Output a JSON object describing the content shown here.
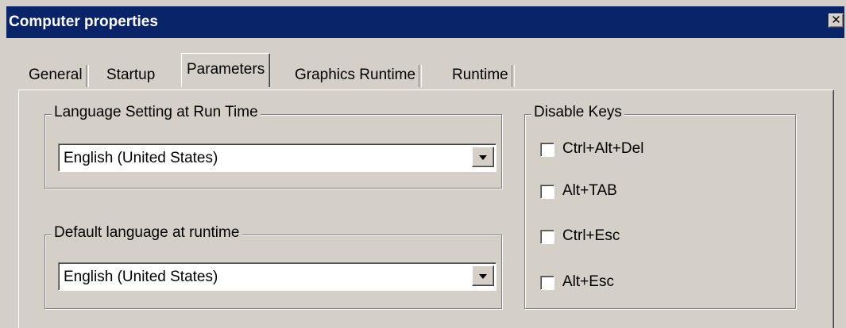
{
  "window": {
    "title": "Computer properties",
    "close_icon": "close-icon"
  },
  "tabs": [
    {
      "label": "General",
      "active": false
    },
    {
      "label": "Startup",
      "active": false
    },
    {
      "label": "Parameters",
      "active": true
    },
    {
      "label": "Graphics Runtime",
      "active": false
    },
    {
      "label": "Runtime",
      "active": false
    }
  ],
  "language_setting": {
    "title": "Language Setting at Run Time",
    "selected": "English (United States)"
  },
  "default_language": {
    "title": "Default language at runtime",
    "selected": "English (United States)"
  },
  "disable_keys": {
    "title": "Disable Keys",
    "items": [
      {
        "label": "Ctrl+Alt+Del",
        "checked": false
      },
      {
        "label": "Alt+TAB",
        "checked": false
      },
      {
        "label": "Ctrl+Esc",
        "checked": false
      },
      {
        "label": "Alt+Esc",
        "checked": false
      }
    ]
  }
}
